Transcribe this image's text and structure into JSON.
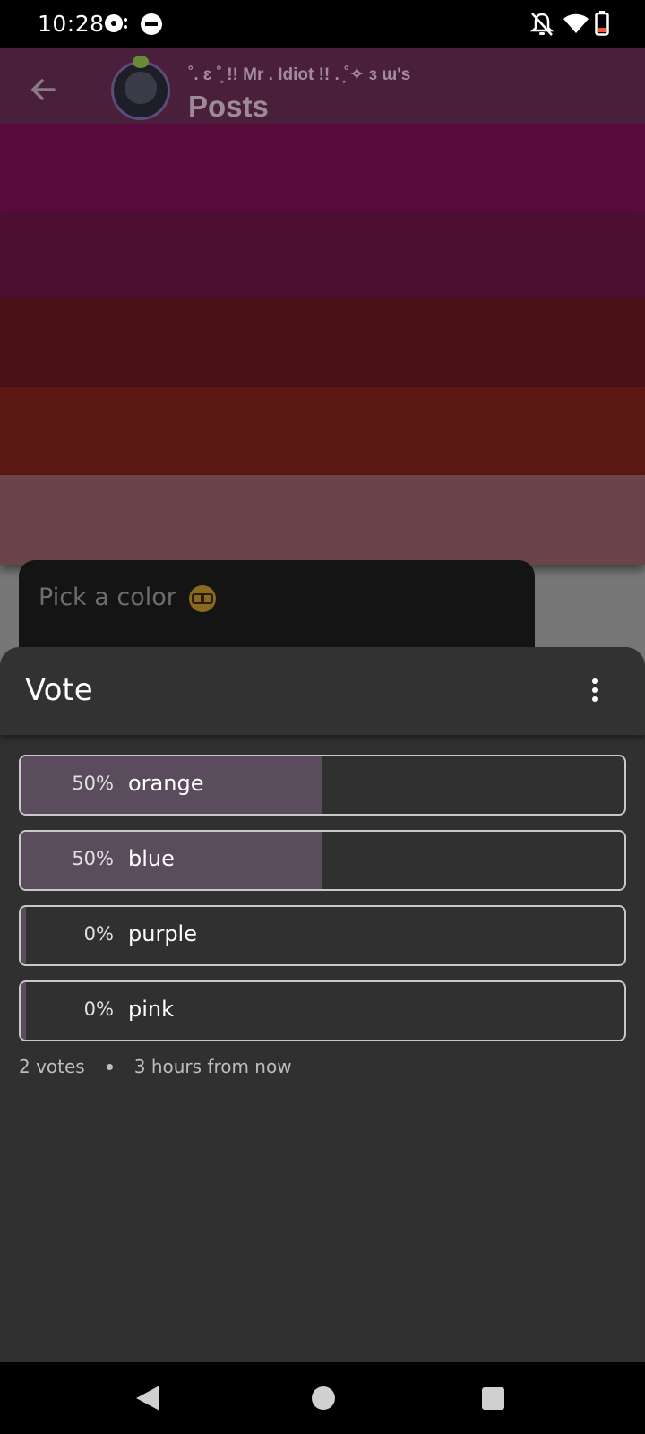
{
  "status_bar": {
    "time": "10:28"
  },
  "header": {
    "owner_line": "˚. ɛ ˚͙ !! Mr . Idiot !! . ͙˚✧ ɜ ɯ's",
    "title": "Posts"
  },
  "background": {
    "stripe_colors": [
      "#5a0b3e",
      "#4d0f31",
      "#4a1216",
      "#5c1812",
      "#6a4448"
    ],
    "post_card": {
      "title": "Pick a color"
    }
  },
  "sheet": {
    "title": "Vote",
    "options": [
      {
        "label": "orange",
        "percent_text": "50%",
        "fraction": 0.5
      },
      {
        "label": "blue",
        "percent_text": "50%",
        "fraction": 0.5
      },
      {
        "label": "purple",
        "percent_text": "0%",
        "fraction": 0.0
      },
      {
        "label": "pink",
        "percent_text": "0%",
        "fraction": 0.0
      }
    ],
    "votes": "2 votes",
    "ends": "3 hours from now"
  },
  "icons": {
    "status_left": [
      "media-icon",
      "do-not-disturb-icon"
    ],
    "status_right": [
      "notifications-off-icon",
      "wifi-icon",
      "battery-icon"
    ],
    "nav": [
      "nav-back-icon",
      "nav-home-icon",
      "nav-recents-icon"
    ]
  }
}
